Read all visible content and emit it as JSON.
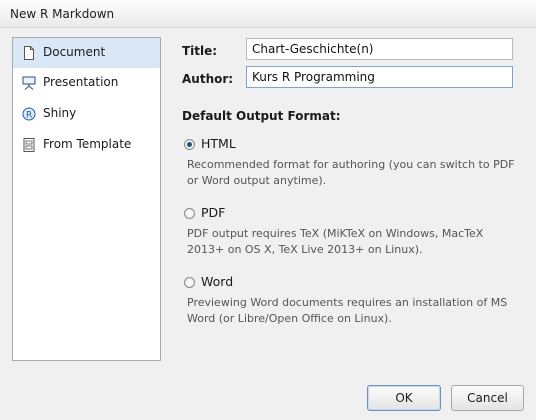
{
  "window": {
    "title": "New R Markdown"
  },
  "sidebar": {
    "items": [
      {
        "label": "Document",
        "icon": "document-icon",
        "selected": true
      },
      {
        "label": "Presentation",
        "icon": "presentation-icon",
        "selected": false
      },
      {
        "label": "Shiny",
        "icon": "shiny-icon",
        "selected": false
      },
      {
        "label": "From Template",
        "icon": "template-icon",
        "selected": false
      }
    ]
  },
  "form": {
    "title_label": "Title:",
    "title_value": "Chart-Geschichte(n)",
    "author_label": "Author:",
    "author_value": "Kurs R Programming",
    "output_heading": "Default Output Format:"
  },
  "formats": [
    {
      "label": "HTML",
      "selected": true,
      "description": "Recommended format for authoring (you can switch to PDF or Word output anytime)."
    },
    {
      "label": "PDF",
      "selected": false,
      "description": "PDF output requires TeX (MiKTeX on Windows, MacTeX 2013+ on OS X, TeX Live 2013+ on Linux)."
    },
    {
      "label": "Word",
      "selected": false,
      "description": "Previewing Word documents requires an installation of MS Word (or Libre/Open Office on Linux)."
    }
  ],
  "buttons": {
    "ok": "OK",
    "cancel": "Cancel"
  }
}
